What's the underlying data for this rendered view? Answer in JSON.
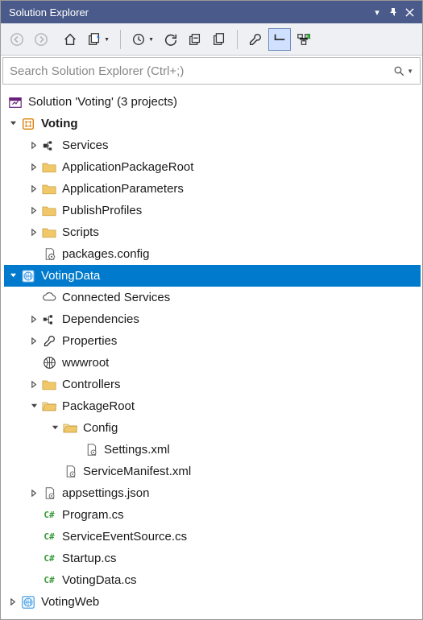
{
  "panel": {
    "title": "Solution Explorer"
  },
  "search": {
    "placeholder": "Search Solution Explorer (Ctrl+;)"
  },
  "solution": {
    "label": "Solution 'Voting' (3 projects)"
  },
  "projects": {
    "voting": {
      "label": "Voting",
      "items": {
        "services": "Services",
        "appPkgRoot": "ApplicationPackageRoot",
        "appParams": "ApplicationParameters",
        "publishProfiles": "PublishProfiles",
        "scripts": "Scripts",
        "packagesConfig": "packages.config"
      }
    },
    "votingData": {
      "label": "VotingData",
      "connectedServices": "Connected Services",
      "dependencies": "Dependencies",
      "properties": "Properties",
      "wwwroot": "wwwroot",
      "controllers": "Controllers",
      "packageRoot": "PackageRoot",
      "config": "Config",
      "settingsXml": "Settings.xml",
      "serviceManifest": "ServiceManifest.xml",
      "appsettings": "appsettings.json",
      "programCs": "Program.cs",
      "serviceEventSource": "ServiceEventSource.cs",
      "startupCs": "Startup.cs",
      "votingDataCs": "VotingData.cs"
    },
    "votingWeb": {
      "label": "VotingWeb"
    }
  }
}
